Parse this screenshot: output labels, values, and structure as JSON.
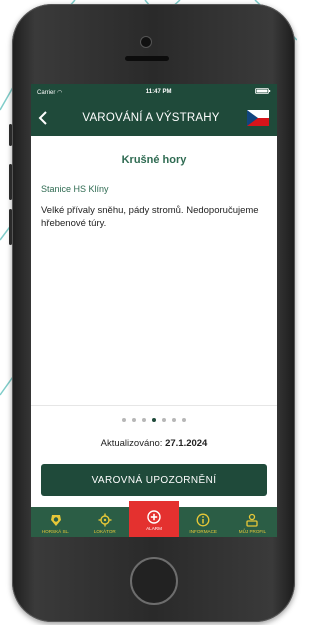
{
  "status_bar": {
    "carrier": "Carrier",
    "time": "11:47 PM"
  },
  "header": {
    "back_icon": "chevron-left-icon",
    "title": "VAROVÁNÍ A VÝSTRAHY",
    "flag": "czech-flag"
  },
  "warning": {
    "region": "Krušné hory",
    "station": "Stanice HS Klíny",
    "message": "Velké přívaly sněhu, pády stromů. Nedoporučujeme hřebenové túry."
  },
  "pagination": {
    "total": 7,
    "active": 4
  },
  "updated": {
    "label": "Aktualizováno:",
    "date": "27.1.2024"
  },
  "warnings_button": "VAROVNÁ UPOZORNĚNÍ",
  "tabbar": {
    "items": [
      {
        "label": "HORSKÁ SL.",
        "icon": "mountain-rescue-badge-icon"
      },
      {
        "label": "LOKÁTOR",
        "icon": "locator-crosshair-icon"
      },
      {
        "label": "ALARM",
        "icon": "alarm-plus-icon"
      },
      {
        "label": "INFORMACE",
        "icon": "info-icon"
      },
      {
        "label": "MŮJ PROFIL",
        "icon": "profile-icon"
      }
    ]
  },
  "colors": {
    "primary": "#1f4a3a",
    "accent": "#e7c838",
    "alarm": "#e4312f",
    "text_green": "#2f6b52"
  }
}
